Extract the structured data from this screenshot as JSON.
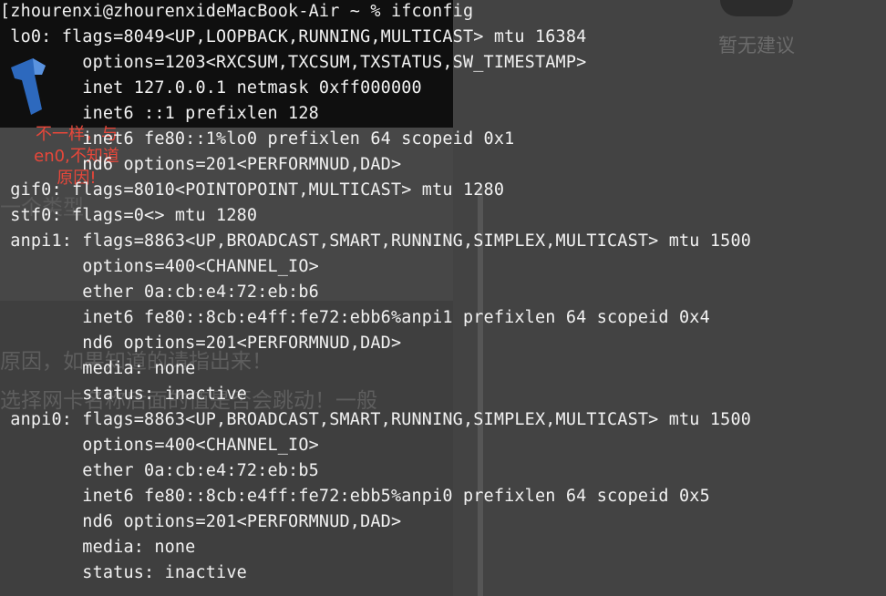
{
  "background": {
    "suggestion_text": "暂无建议",
    "body_line_1": "原因，如果知道的请指出来！",
    "body_line_2": "选择网卡名称后面的值是否会跳动！一般",
    "body_line_3": "一个类型",
    "annotation": "不一样，与\nen0,不知道\n原因!"
  },
  "colors": {
    "terminal_text": "#f2f2f2",
    "annotation": "#e8473a",
    "logo_blue": "#2f6fc8"
  },
  "terminal": {
    "prompt": "zhourenxi@zhourenxideMacBook-Air ~ % ifconfig",
    "lines": [
      "[zhourenxi@zhourenxideMacBook-Air ~ % ifconfig",
      " lo0: flags=8049<UP,LOOPBACK,RUNNING,MULTICAST> mtu 16384",
      "        options=1203<RXCSUM,TXCSUM,TXSTATUS,SW_TIMESTAMP>",
      "        inet 127.0.0.1 netmask 0xff000000",
      "        inet6 ::1 prefixlen 128",
      "        inet6 fe80::1%lo0 prefixlen 64 scopeid 0x1",
      "        nd6 options=201<PERFORMNUD,DAD>",
      " gif0: flags=8010<POINTOPOINT,MULTICAST> mtu 1280",
      " stf0: flags=0<> mtu 1280",
      " anpi1: flags=8863<UP,BROADCAST,SMART,RUNNING,SIMPLEX,MULTICAST> mtu 1500",
      "        options=400<CHANNEL_IO>",
      "        ether 0a:cb:e4:72:eb:b6",
      "        inet6 fe80::8cb:e4ff:fe72:ebb6%anpi1 prefixlen 64 scopeid 0x4",
      "        nd6 options=201<PERFORMNUD,DAD>",
      "        media: none",
      "        status: inactive",
      " anpi0: flags=8863<UP,BROADCAST,SMART,RUNNING,SIMPLEX,MULTICAST> mtu 1500",
      "        options=400<CHANNEL_IO>",
      "        ether 0a:cb:e4:72:eb:b5",
      "        inet6 fe80::8cb:e4ff:fe72:ebb5%anpi0 prefixlen 64 scopeid 0x5",
      "        nd6 options=201<PERFORMNUD,DAD>",
      "        media: none",
      "        status: inactive"
    ]
  }
}
